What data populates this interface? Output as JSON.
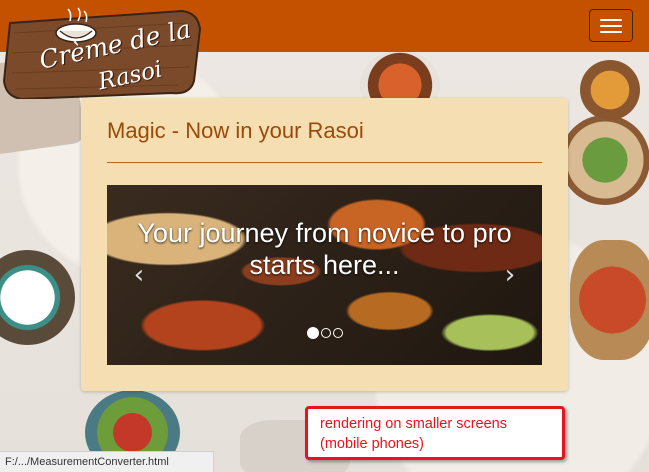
{
  "navbar": {
    "brand_line1": "Crème de la",
    "brand_line2": "Rasoi",
    "toggle_icon": "hamburger-menu-icon",
    "background_color": "#c45100"
  },
  "card": {
    "title": "Magic - Now in your Rasoi",
    "background_color": "#f5dfb2",
    "title_color": "#9a4a08"
  },
  "carousel": {
    "caption": "Your journey from novice to pro starts here...",
    "prev_icon": "chevron-left-icon",
    "next_icon": "chevron-right-icon",
    "prev_glyph": "‹",
    "next_glyph": "›",
    "slide_count": 3,
    "active_slide": 1
  },
  "statusbar": {
    "url": "F:/.../MeasurementConverter.html"
  },
  "annotation": {
    "text": "rendering on smaller screens (mobile phones)",
    "border_color": "#e8141c"
  }
}
